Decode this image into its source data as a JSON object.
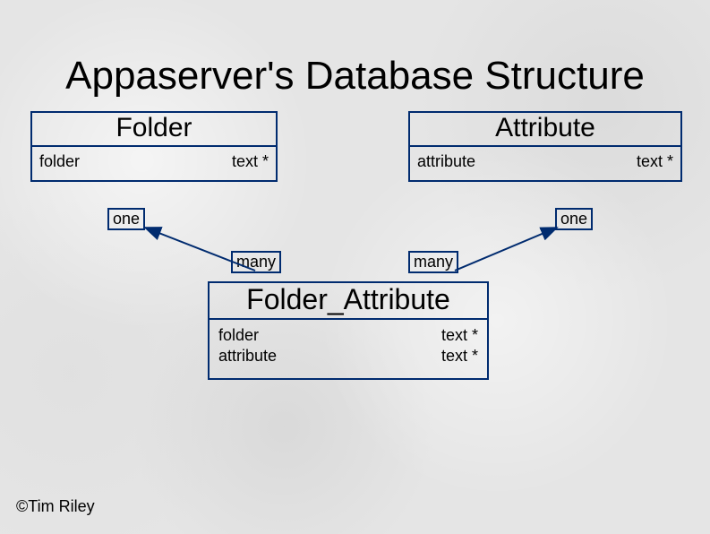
{
  "title": "Appaserver's Database Structure",
  "entities": {
    "folder": {
      "name": "Folder",
      "field": "folder",
      "type": "text *"
    },
    "attribute": {
      "name": "Attribute",
      "field": "attribute",
      "type": "text *"
    },
    "folder_attribute": {
      "name": "Folder_Attribute",
      "fields": [
        "folder",
        "attribute"
      ],
      "types": [
        "text *",
        "text *"
      ]
    }
  },
  "cardinality": {
    "one_left": "one",
    "one_right": "one",
    "many_left": "many",
    "many_right": "many"
  },
  "copyright": "©Tim Riley"
}
